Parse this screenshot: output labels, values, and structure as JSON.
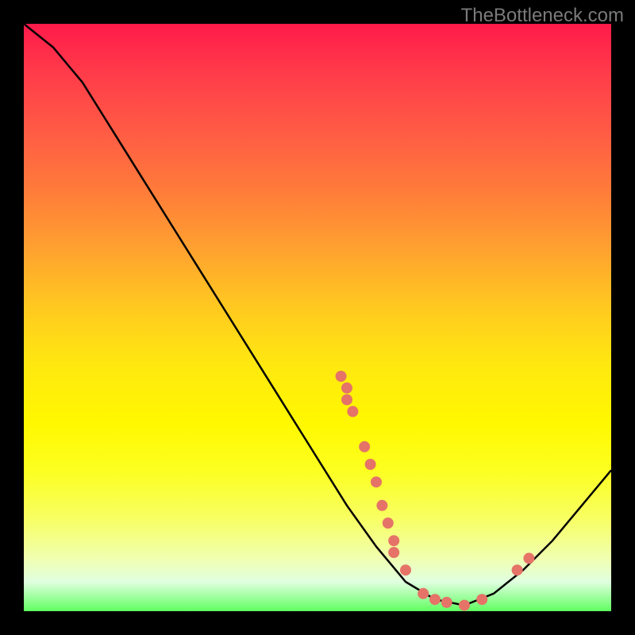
{
  "watermark": "TheBottleneck.com",
  "chart_data": {
    "type": "line",
    "title": "",
    "xlabel": "",
    "ylabel": "",
    "xlim": [
      0,
      100
    ],
    "ylim": [
      0,
      100
    ],
    "curve": [
      {
        "x": 0,
        "y": 100
      },
      {
        "x": 5,
        "y": 96
      },
      {
        "x": 10,
        "y": 90
      },
      {
        "x": 15,
        "y": 82
      },
      {
        "x": 20,
        "y": 74
      },
      {
        "x": 25,
        "y": 66
      },
      {
        "x": 30,
        "y": 58
      },
      {
        "x": 35,
        "y": 50
      },
      {
        "x": 40,
        "y": 42
      },
      {
        "x": 45,
        "y": 34
      },
      {
        "x": 50,
        "y": 26
      },
      {
        "x": 55,
        "y": 18
      },
      {
        "x": 60,
        "y": 11
      },
      {
        "x": 65,
        "y": 5
      },
      {
        "x": 70,
        "y": 2
      },
      {
        "x": 75,
        "y": 1
      },
      {
        "x": 80,
        "y": 3
      },
      {
        "x": 85,
        "y": 7
      },
      {
        "x": 90,
        "y": 12
      },
      {
        "x": 95,
        "y": 18
      },
      {
        "x": 100,
        "y": 24
      }
    ],
    "markers": [
      {
        "x": 54,
        "y": 40
      },
      {
        "x": 55,
        "y": 38
      },
      {
        "x": 55,
        "y": 36
      },
      {
        "x": 56,
        "y": 34
      },
      {
        "x": 58,
        "y": 28
      },
      {
        "x": 59,
        "y": 25
      },
      {
        "x": 60,
        "y": 22
      },
      {
        "x": 61,
        "y": 18
      },
      {
        "x": 62,
        "y": 15
      },
      {
        "x": 63,
        "y": 12
      },
      {
        "x": 63,
        "y": 10
      },
      {
        "x": 65,
        "y": 7
      },
      {
        "x": 68,
        "y": 3
      },
      {
        "x": 70,
        "y": 2
      },
      {
        "x": 72,
        "y": 1.5
      },
      {
        "x": 75,
        "y": 1
      },
      {
        "x": 78,
        "y": 2
      },
      {
        "x": 84,
        "y": 7
      },
      {
        "x": 86,
        "y": 9
      }
    ],
    "curve_color": "#000000",
    "marker_color": "#e57368",
    "marker_radius": 7
  }
}
